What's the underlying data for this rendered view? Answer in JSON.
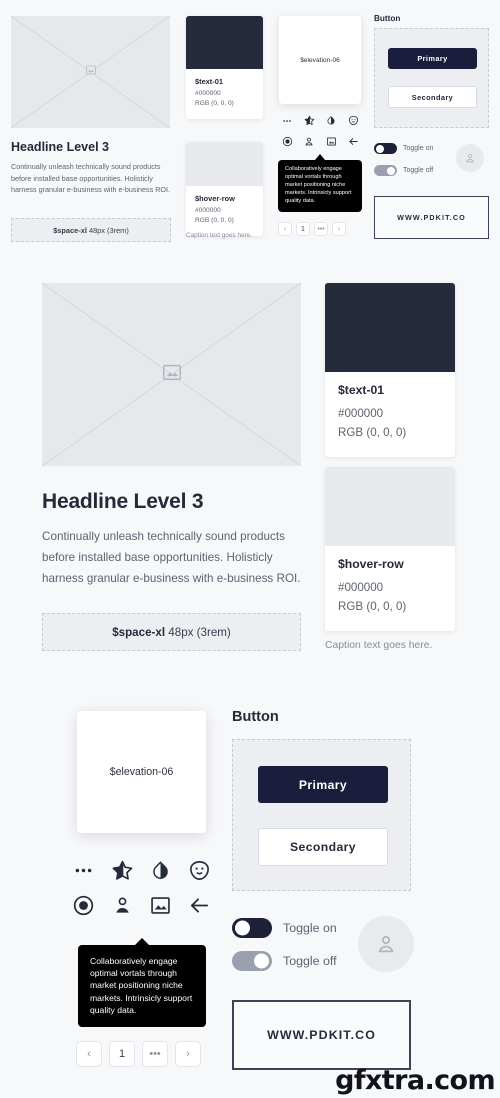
{
  "background": "#f7f8fa",
  "colors": {
    "dark_swatch": "#262b3c",
    "light_swatch": "#e7e9ec",
    "primary_button": "#1b1d3c",
    "toggle_on": "#1d2138",
    "toggle_off": "#9aa0ad",
    "tooltip_bg": "#000000",
    "text_primary": "#252a39",
    "text_muted": "#5d6470"
  },
  "content": {
    "headline": "Headline Level 3",
    "body": "Continually unleash technically sound products before installed base opportunities. Holisticly harness granular e-business with e-business ROI.",
    "space_token": "$space-xl",
    "space_value": "48px (3rem)",
    "caption": "Caption text goes here.",
    "elevation_label": "$elevation-06",
    "image_placeholder_icon": "image-icon"
  },
  "swatches": [
    {
      "name": "$text-01",
      "hex": "#000000",
      "rgb": "RGB (0, 0, 0)",
      "chip": "#262b3c"
    },
    {
      "name": "$hover-row",
      "hex": "#000000",
      "rgb": "RGB (0, 0, 0)",
      "chip": "#e7e9ec"
    }
  ],
  "icons": [
    {
      "name": "more-horizontal-icon"
    },
    {
      "name": "star-half-icon"
    },
    {
      "name": "opacity-droplet-icon"
    },
    {
      "name": "mood-face-icon"
    },
    {
      "name": "radio-button-checked-icon"
    },
    {
      "name": "person-icon"
    },
    {
      "name": "image-icon"
    },
    {
      "name": "arrow-left-icon"
    }
  ],
  "tooltip": {
    "text": "Collaboratively engage optimal vortals through market positioning niche markets. Intrinsicly support quality data."
  },
  "pagination": {
    "prev": "‹",
    "page": "1",
    "ellipsis": "•••",
    "next": "›"
  },
  "buttons": {
    "section_label": "Button",
    "primary": "Primary",
    "secondary": "Secondary"
  },
  "toggles": [
    {
      "label": "Toggle on",
      "state": "on"
    },
    {
      "label": "Toggle off",
      "state": "off"
    }
  ],
  "avatar": {
    "icon": "person-icon"
  },
  "url_box": {
    "text": "WWW.PDKIT.CO"
  },
  "watermark": {
    "text": "gfxtra.com"
  }
}
